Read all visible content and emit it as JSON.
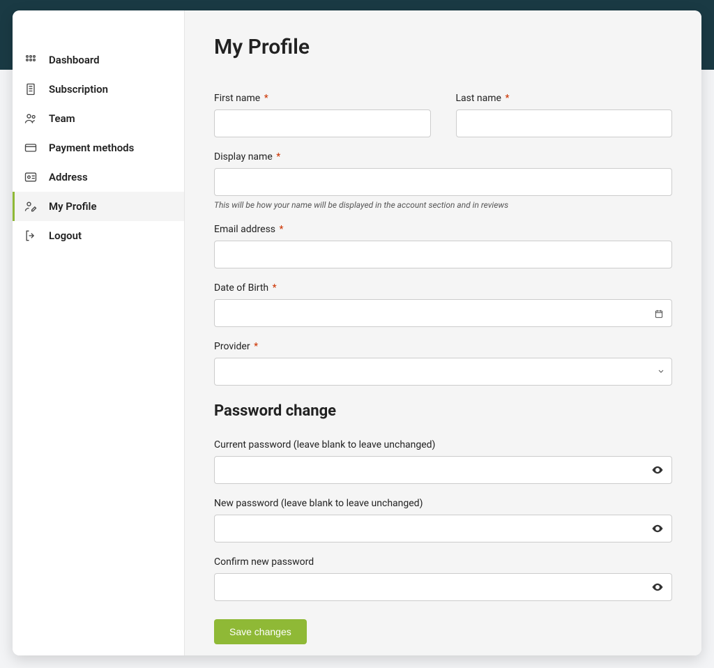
{
  "sidebar": {
    "items": [
      {
        "label": "Dashboard"
      },
      {
        "label": "Subscription"
      },
      {
        "label": "Team"
      },
      {
        "label": "Payment methods"
      },
      {
        "label": "Address"
      },
      {
        "label": "My Profile"
      },
      {
        "label": "Logout"
      }
    ]
  },
  "page": {
    "title": "My Profile"
  },
  "form": {
    "first_name_label": "First name",
    "last_name_label": "Last name",
    "display_name_label": "Display name",
    "display_name_hint": "This will be how your name will be displayed in the account section and in reviews",
    "email_label": "Email address",
    "dob_label": "Date of Birth",
    "provider_label": "Provider",
    "first_name_value": "",
    "last_name_value": "",
    "display_name_value": "",
    "email_value": "",
    "dob_value": "",
    "provider_value": ""
  },
  "password_section": {
    "title": "Password change",
    "current_label": "Current password (leave blank to leave unchanged)",
    "new_label": "New password (leave blank to leave unchanged)",
    "confirm_label": "Confirm new password",
    "current_value": "",
    "new_value": "",
    "confirm_value": ""
  },
  "actions": {
    "save_label": "Save changes"
  },
  "required_marker": "*"
}
